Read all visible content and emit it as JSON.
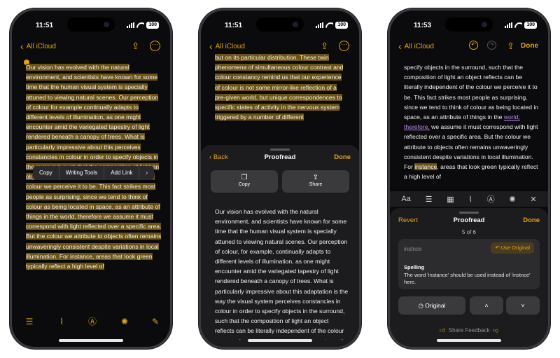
{
  "time1": "11:51",
  "time2": "11:51",
  "time3": "11:53",
  "battery": "100",
  "back_label": "All iCloud",
  "done": "Done",
  "context_menu": [
    "Copy",
    "Writing Tools",
    "Add Link",
    "›"
  ],
  "note1": "Our vision has evolved with the natural environment, and scientists have known for some time that the human visual system is specially attuned to viewing natural scenes. Our perception of colour for example continually adapts to different levels of illumination, as one might encounter amid the variegated tapestry of light rendered beneath a canopy of trees. What is particularly impressive about this perceives constancies in colour in order to specify objects in the surround, such that the composition of light an object reflects can be literally independent of the colour we perceive it to be. This fact strikes most people as surprising, since we tend to think of colour as being located in space, as an attribute of things in the world, therefore we assume it must correspond with light reflected over a specific area. But the colour we attribute to objects often remains unwaveringly consistent despite variations in local illumination. For instance, areas that look green typically reflect a high level of",
  "note2_top": "but on its particular distribution. These twin phenomena of simultaneous colour contrast and colour constancy remind us that our experience of colour is not some mirror-like reflection of a pre-given world, but unique correspondences to specific states of activity in the nervous system triggered by a number of different",
  "proofread": {
    "back": "Back",
    "title": "Proofread",
    "done": "Done",
    "copy": "Copy",
    "share": "Share",
    "body": "Our vision has evolved with the natural environment, and scientists have known for some time that the human visual system is specially attuned to viewing natural scenes. Our perception of colour, for example, continually adapts to different levels of illumination, as one might encounter amid the variegated tapestry of light rendered beneath a canopy of trees. What is particularly impressive about this adaptation is the way the visual system perceives constancies in colour in order to specify objects in the surround, such that the composition of light an object reflects can be literally independent of the colour we perceive it to be. This fact strikes most people as surprising, since we"
  },
  "note3": {
    "a": "specify objects in the surround, such that the composition of light an object reflects can be literally independent of the colour we perceive it to be. This fact strikes most people as surprising, since we tend to think of colour as being located in space, as an attribute of things in the ",
    "b": "world; therefore,",
    "c": " we assume it must correspond with light reflected over a specific area. But the colour we attribute to objects often remains unwaveringly consistent despite variations in local illumination. For ",
    "d": "instance",
    "e": ", areas that look green typically reflect a high level of"
  },
  "panel": {
    "revert": "Revert",
    "title": "Proofread",
    "done": "Done",
    "counter": "5 of 6",
    "word": "instnce",
    "use_original": "Use Original",
    "heading": "Spelling",
    "desc": "The word 'instance' should be used instead of 'instnce' here.",
    "original": "Original",
    "feedback": "Share Feedback"
  },
  "icons": [
    "share-icon",
    "more-icon",
    "checklist-icon",
    "paperclip-icon",
    "pen-icon",
    "writing-tools-icon",
    "compose-icon",
    "undo-icon",
    "redo-icon",
    "format-icon",
    "table-icon",
    "close-icon",
    "thumbs-up-icon",
    "thumbs-down-icon"
  ],
  "accent": "#e5a318"
}
